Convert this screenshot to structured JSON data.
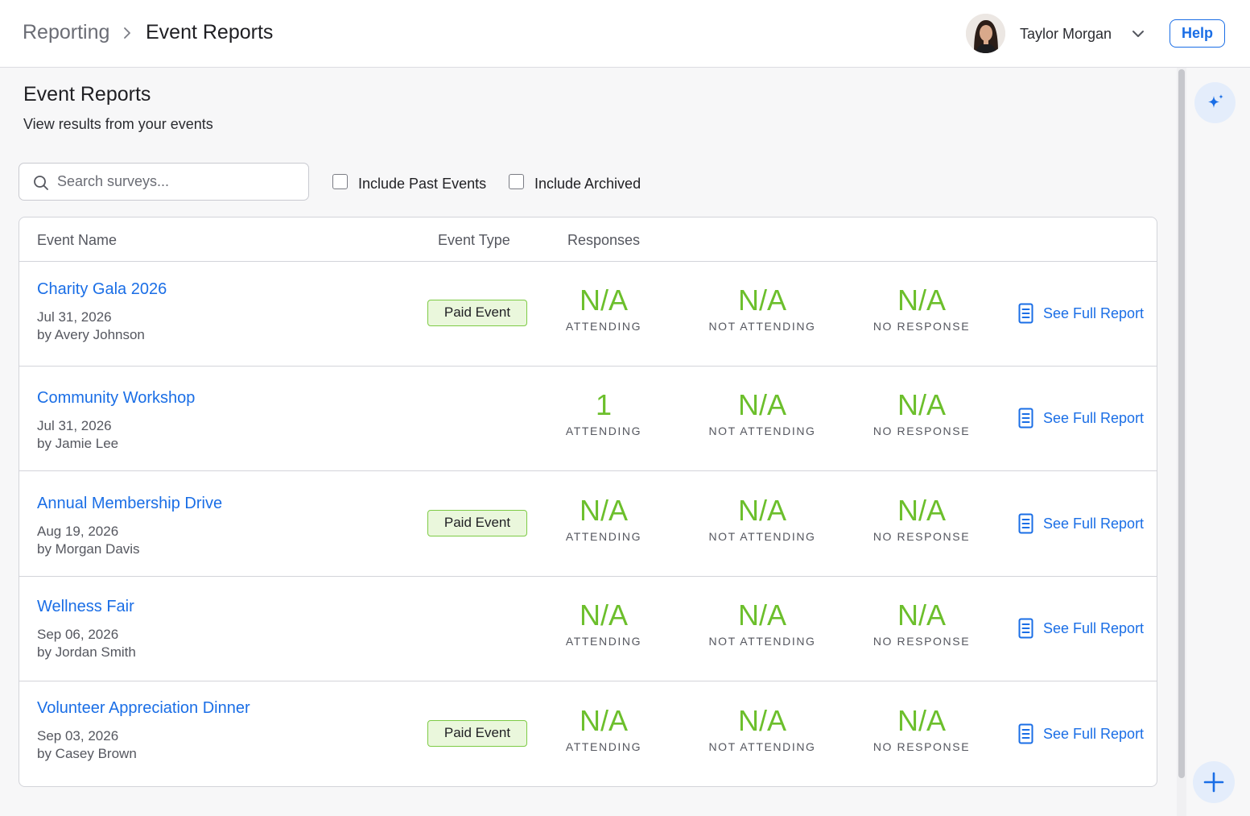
{
  "header": {
    "breadcrumb_parent": "Reporting",
    "breadcrumb_current": "Event Reports",
    "user_name": "Taylor Morgan",
    "help_label": "Help"
  },
  "page": {
    "title": "Event Reports",
    "subtitle": "View results from your events"
  },
  "filters": {
    "search_placeholder": "Search surveys...",
    "search_value": "",
    "include_past_label": "Include Past Events",
    "include_past_checked": false,
    "include_archived_label": "Include Archived",
    "include_archived_checked": false
  },
  "table": {
    "columns": [
      "Event Name",
      "Event Type",
      "Responses"
    ],
    "report_link_label": "See Full Report",
    "stat_captions": [
      "ATTENDING",
      "NOT ATTENDING",
      "NO RESPONSE"
    ],
    "rows": [
      {
        "name": "Charity Gala 2026",
        "date": "Jul 31, 2026",
        "by": "by Avery Johnson",
        "type": "Paid Event",
        "attending": "N/A",
        "not_attending": "N/A",
        "no_response": "N/A"
      },
      {
        "name": "Community Workshop",
        "date": "Jul 31, 2026",
        "by": "by Jamie Lee",
        "type": "",
        "attending": "1",
        "not_attending": "N/A",
        "no_response": "N/A"
      },
      {
        "name": "Annual Membership Drive",
        "date": "Aug 19, 2026",
        "by": "by Morgan Davis",
        "type": "Paid Event",
        "attending": "N/A",
        "not_attending": "N/A",
        "no_response": "N/A"
      },
      {
        "name": "Wellness Fair",
        "date": "Sep 06, 2026",
        "by": "by Jordan Smith",
        "type": "",
        "attending": "N/A",
        "not_attending": "N/A",
        "no_response": "N/A"
      },
      {
        "name": "Volunteer Appreciation Dinner",
        "date": "Sep 03, 2026",
        "by": "by Casey Brown",
        "type": "Paid Event",
        "attending": "N/A",
        "not_attending": "N/A",
        "no_response": "N/A"
      }
    ]
  },
  "colors": {
    "accent": "#1a6ee6",
    "stat_green": "#6cbf2c",
    "badge_bg": "#eaf7dc",
    "badge_border": "#7ecb45"
  },
  "icons": {
    "breadcrumb_separator": "chevron-right-icon",
    "user_menu": "chevron-down-icon",
    "search": "search-icon",
    "report": "document-icon",
    "ai": "sparkle-icon",
    "add": "plus-icon"
  }
}
